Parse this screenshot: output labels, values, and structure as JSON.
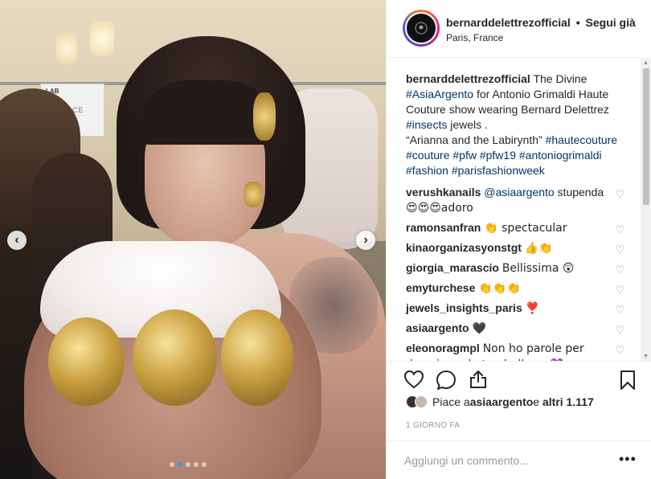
{
  "header": {
    "username": "bernarddelettrezofficial",
    "separator": "•",
    "follow_label": "Segui già",
    "location": "Paris, France"
  },
  "photo_sign": {
    "line1": "LAB",
    "line2": "CANDICE"
  },
  "carousel": {
    "prev": "‹",
    "next": "›",
    "slides": 5,
    "active_slide": 1
  },
  "caption": {
    "username": "bernarddelettrezofficial",
    "t1": " The Divine ",
    "tag1": "#AsiaArgento",
    "t2": " for Antonio Grimaldi Haute Couture show wearing Bernard Delettrez ",
    "tag2": "#insects",
    "t3": " jewels .",
    "quote": "“Arianna and the Labirynth” ",
    "tag3": "#hautecouture",
    "tag4": "#couture",
    "tag5": "#pfw",
    "tag6": "#pfw19",
    "tag7": "#antoniogrimaldi",
    "tag8": "#fashion",
    "tag9": "#parisfashionweek"
  },
  "comments": [
    {
      "user": "verushkanails",
      "mention": "@asiaargento",
      "text": " stupenda",
      "text2": "😍😍😍adoro"
    },
    {
      "user": "ramonsanfran",
      "text": "👏 spectacular"
    },
    {
      "user": "kinaorganizasyonstgt",
      "text": "👍👏"
    },
    {
      "user": "giorgia_marascio",
      "text": "Bellissima 😲"
    },
    {
      "user": "emyturchese",
      "text": "👏👏👏"
    },
    {
      "user": "jewels_insights_paris",
      "text": "❣️"
    },
    {
      "user": "asiaargento",
      "text": "🖤"
    },
    {
      "user": "eleonoragmpl",
      "text": "Non ho parole per descrivere la tua bellezza💜"
    }
  ],
  "likes": {
    "prefix": "Piace a ",
    "user": "asiaargento",
    "middle": " e ",
    "others": "altri 1.117"
  },
  "timestamp": "1 GIORNO FA",
  "add_comment": {
    "placeholder": "Aggiungi un commento..."
  },
  "more_label": "•••",
  "icons": {
    "heart": "heart-icon",
    "comment": "comment-icon",
    "share": "share-icon",
    "bookmark": "bookmark-icon"
  },
  "colors": {
    "hashtag": "#003569",
    "text": "#262626",
    "muted": "#999999",
    "active_dot": "#3897f0"
  }
}
